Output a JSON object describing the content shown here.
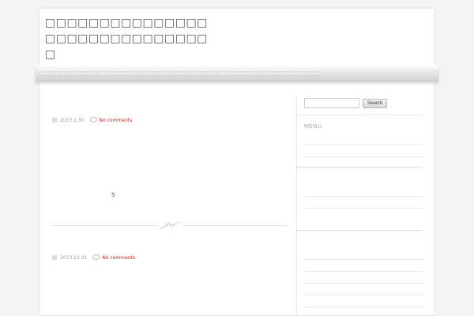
{
  "site": {
    "title": "□□□□□□□□□□□□□□□□□□□□□□□□□□□□□□□"
  },
  "nav": {
    "items": [
      {
        "label": "□□□□□□□□□□□□□□□□□□□□□□□□□□□□□"
      },
      {
        "label": "□□□□□□□□□□□□□□□□□□□□□□□□□□□□□"
      }
    ]
  },
  "posts": [
    {
      "date": "2013.1.30",
      "comments": "No comments",
      "excerpt": "5"
    },
    {
      "date": "2013.12.31",
      "comments": "No comments"
    }
  ],
  "sidebar": {
    "search_placeholder": "",
    "search_button": "Search",
    "menu_title": "MENU"
  }
}
